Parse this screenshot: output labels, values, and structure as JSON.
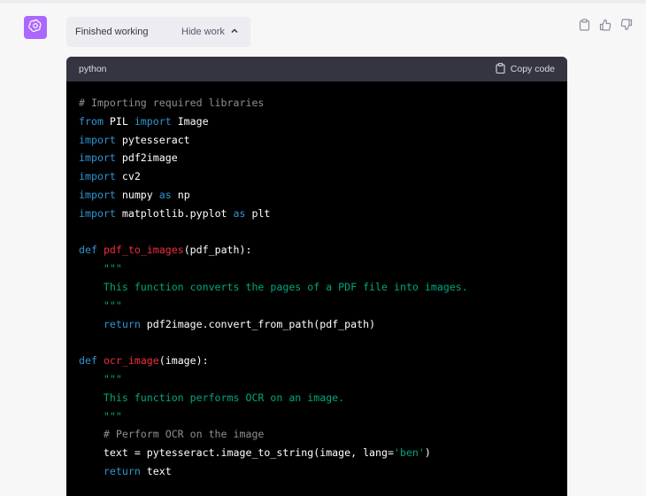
{
  "status": {
    "text": "Finished working",
    "hide_label": "Hide work"
  },
  "icons": {
    "avatar": "openai-logo-icon",
    "copy_message": "clipboard-icon",
    "thumbs_up": "thumbs-up-icon",
    "thumbs_down": "thumbs-down-icon",
    "chevron": "chevron-up-icon"
  },
  "colors": {
    "avatar_bg": "#ab68ff",
    "keyword": "#2e95d3",
    "function_name": "#f22c3d",
    "comment": "#8f8f8f",
    "docstring": "#00a67d"
  },
  "code": {
    "language": "python",
    "copy_label": "Copy code",
    "lines": [
      [
        {
          "t": "# Importing required libraries",
          "c": "cm"
        }
      ],
      [
        {
          "t": "from",
          "c": "kw"
        },
        {
          "t": " PIL ",
          "c": "plain"
        },
        {
          "t": "import",
          "c": "kw"
        },
        {
          "t": " Image",
          "c": "plain"
        }
      ],
      [
        {
          "t": "import",
          "c": "kw"
        },
        {
          "t": " pytesseract",
          "c": "plain"
        }
      ],
      [
        {
          "t": "import",
          "c": "kw"
        },
        {
          "t": " pdf2image",
          "c": "plain"
        }
      ],
      [
        {
          "t": "import",
          "c": "kw"
        },
        {
          "t": " cv2",
          "c": "plain"
        }
      ],
      [
        {
          "t": "import",
          "c": "kw"
        },
        {
          "t": " numpy ",
          "c": "plain"
        },
        {
          "t": "as",
          "c": "kw"
        },
        {
          "t": " np",
          "c": "plain"
        }
      ],
      [
        {
          "t": "import",
          "c": "kw"
        },
        {
          "t": " matplotlib.pyplot ",
          "c": "plain"
        },
        {
          "t": "as",
          "c": "kw"
        },
        {
          "t": " plt",
          "c": "plain"
        }
      ],
      [],
      [
        {
          "t": "def",
          "c": "kw"
        },
        {
          "t": " ",
          "c": "plain"
        },
        {
          "t": "pdf_to_images",
          "c": "fn"
        },
        {
          "t": "(pdf_path):",
          "c": "plain"
        }
      ],
      [
        {
          "t": "    \"\"\"",
          "c": "doc"
        }
      ],
      [
        {
          "t": "    This function converts the pages of a PDF file into images.",
          "c": "doc"
        }
      ],
      [
        {
          "t": "    \"\"\"",
          "c": "doc"
        }
      ],
      [
        {
          "t": "    ",
          "c": "plain"
        },
        {
          "t": "return",
          "c": "kw"
        },
        {
          "t": " pdf2image.convert_from_path(pdf_path)",
          "c": "plain"
        }
      ],
      [],
      [
        {
          "t": "def",
          "c": "kw"
        },
        {
          "t": " ",
          "c": "plain"
        },
        {
          "t": "ocr_image",
          "c": "fn"
        },
        {
          "t": "(image):",
          "c": "plain"
        }
      ],
      [
        {
          "t": "    \"\"\"",
          "c": "doc"
        }
      ],
      [
        {
          "t": "    This function performs OCR on an image.",
          "c": "doc"
        }
      ],
      [
        {
          "t": "    \"\"\"",
          "c": "doc"
        }
      ],
      [
        {
          "t": "    # Perform OCR on the image",
          "c": "cm"
        }
      ],
      [
        {
          "t": "    text = pytesseract.image_to_string(image, lang=",
          "c": "plain"
        },
        {
          "t": "'ben'",
          "c": "str"
        },
        {
          "t": ")",
          "c": "plain"
        }
      ],
      [
        {
          "t": "    ",
          "c": "plain"
        },
        {
          "t": "return",
          "c": "kw"
        },
        {
          "t": " text",
          "c": "plain"
        }
      ]
    ]
  }
}
